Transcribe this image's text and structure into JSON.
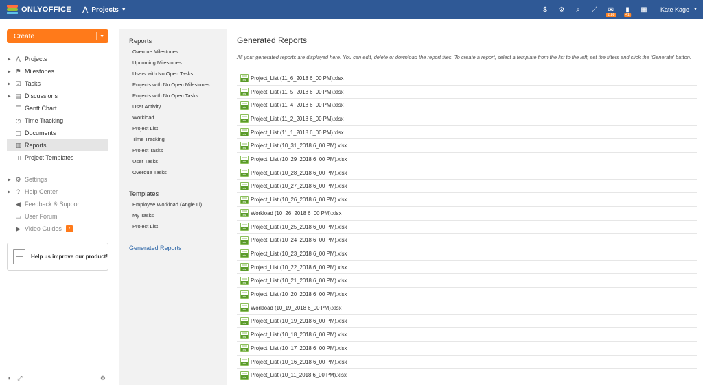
{
  "topbar": {
    "logo": "ONLYOFFICE",
    "module": "Projects",
    "icons": [
      {
        "name": "payment-icon",
        "glyph": "$"
      },
      {
        "name": "settings-icon",
        "glyph": "⚙"
      },
      {
        "name": "search-icon",
        "glyph": "⌕"
      },
      {
        "name": "feed-icon",
        "glyph": "⟋"
      },
      {
        "name": "mail-icon",
        "glyph": "✉",
        "badge": "1188"
      },
      {
        "name": "chat-icon",
        "glyph": "▮",
        "badge": "41"
      },
      {
        "name": "calendar-icon",
        "glyph": "▦"
      }
    ],
    "user": "Kate Kage"
  },
  "sidebar": {
    "create": "Create",
    "items": [
      {
        "label": "Projects",
        "icon": "projects-icon",
        "glyph": "⋀",
        "expandable": true
      },
      {
        "label": "Milestones",
        "icon": "flag-icon",
        "glyph": "⚑",
        "expandable": true
      },
      {
        "label": "Tasks",
        "icon": "tasks-icon",
        "glyph": "☑",
        "expandable": true
      },
      {
        "label": "Discussions",
        "icon": "discussions-icon",
        "glyph": "▤",
        "expandable": true
      },
      {
        "label": "Gantt Chart",
        "icon": "gantt-icon",
        "glyph": "☰",
        "expandable": false
      },
      {
        "label": "Time Tracking",
        "icon": "clock-icon",
        "glyph": "◷",
        "expandable": false
      },
      {
        "label": "Documents",
        "icon": "documents-icon",
        "glyph": "▢",
        "expandable": false
      },
      {
        "label": "Reports",
        "icon": "reports-icon",
        "glyph": "▥",
        "expandable": false,
        "active": true
      },
      {
        "label": "Project Templates",
        "icon": "templates-icon",
        "glyph": "◫",
        "expandable": false
      }
    ],
    "secondary": [
      {
        "label": "Settings",
        "icon": "gear-icon",
        "glyph": "⚙",
        "expandable": true
      },
      {
        "label": "Help Center",
        "icon": "help-icon",
        "glyph": "?",
        "expandable": true
      },
      {
        "label": "Feedback & Support",
        "icon": "megaphone-icon",
        "glyph": "◀",
        "expandable": false
      },
      {
        "label": "User Forum",
        "icon": "forum-icon",
        "glyph": "▭",
        "expandable": false
      },
      {
        "label": "Video Guides",
        "icon": "video-icon",
        "glyph": "▶",
        "expandable": false,
        "badge": "7"
      }
    ],
    "improve": "Help us improve our product!"
  },
  "reports_panel": {
    "reports_heading": "Reports",
    "reports": [
      "Overdue Milestones",
      "Upcoming Milestones",
      "Users with No Open Tasks",
      "Projects with No Open Milestones",
      "Projects with No Open Tasks",
      "User Activity",
      "Workload",
      "Project List",
      "Time Tracking",
      "Project Tasks",
      "User Tasks",
      "Overdue Tasks"
    ],
    "templates_heading": "Templates",
    "templates": [
      "Employee Workload (Angie Li)",
      "My Tasks",
      "Project List"
    ],
    "generated_link": "Generated Reports"
  },
  "main": {
    "title": "Generated Reports",
    "description": "All your generated reports are displayed here. You can edit, delete or download the report files. To create a report, select a template from the list to the left, set the filters and click the 'Generate' button.",
    "files": [
      "Project_List (11_6_2018 6_00 PM).xlsx",
      "Project_List (11_5_2018 6_00 PM).xlsx",
      "Project_List (11_4_2018 6_00 PM).xlsx",
      "Project_List (11_2_2018 6_00 PM).xlsx",
      "Project_List (11_1_2018 6_00 PM).xlsx",
      "Project_List (10_31_2018 6_00 PM).xlsx",
      "Project_List (10_29_2018 6_00 PM).xlsx",
      "Project_List (10_28_2018 6_00 PM).xlsx",
      "Project_List (10_27_2018 6_00 PM).xlsx",
      "Project_List (10_26_2018 6_00 PM).xlsx",
      "Workload (10_26_2018 6_00 PM).xlsx",
      "Project_List (10_25_2018 6_00 PM).xlsx",
      "Project_List (10_24_2018 6_00 PM).xlsx",
      "Project_List (10_23_2018 6_00 PM).xlsx",
      "Project_List (10_22_2018 6_00 PM).xlsx",
      "Project_List (10_21_2018 6_00 PM).xlsx",
      "Project_List (10_20_2018 6_00 PM).xlsx",
      "Workload (10_19_2018 6_00 PM).xlsx",
      "Project_List (10_19_2018 6_00 PM).xlsx",
      "Project_List (10_18_2018 6_00 PM).xlsx",
      "Project_List (10_17_2018 6_00 PM).xlsx",
      "Project_List (10_16_2018 6_00 PM).xlsx",
      "Project_List (10_11_2018 6_00 PM).xlsx"
    ]
  },
  "colors": {
    "topbar": "#2f5996",
    "create": "#ff7a1a",
    "link": "#3068a8",
    "panel": "#f2f2f2"
  }
}
